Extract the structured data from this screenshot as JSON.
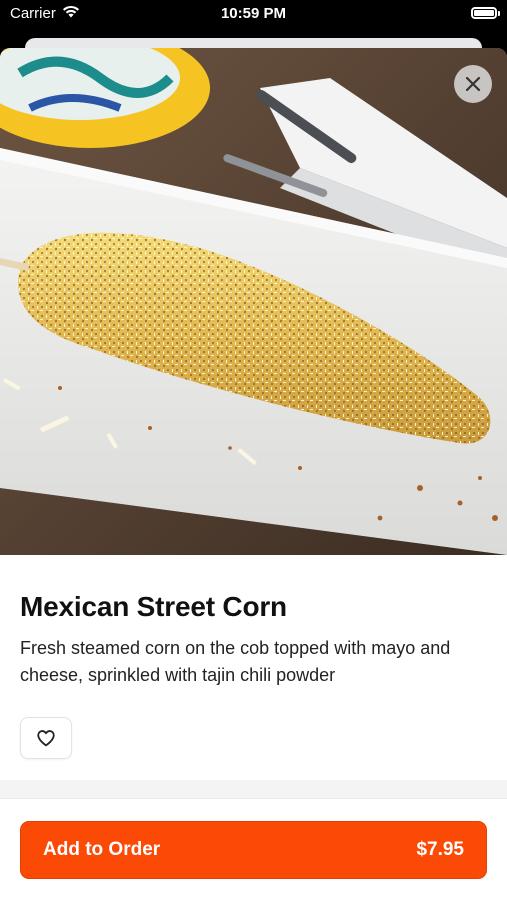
{
  "status_bar": {
    "carrier": "Carrier",
    "time": "10:59 PM"
  },
  "item": {
    "title": "Mexican Street Corn",
    "description": "Fresh steamed corn on the cob topped with mayo and cheese, sprinkled with tajin chili powder",
    "image_alt": "corn-on-the-cob-photo"
  },
  "actions": {
    "close_icon": "close-icon",
    "favorite_icon": "heart-icon",
    "add_label": "Add to Order",
    "price": "$7.95"
  },
  "colors": {
    "accent": "#fb4a06",
    "background": "#ffffff",
    "divider": "#f4f4f5"
  }
}
